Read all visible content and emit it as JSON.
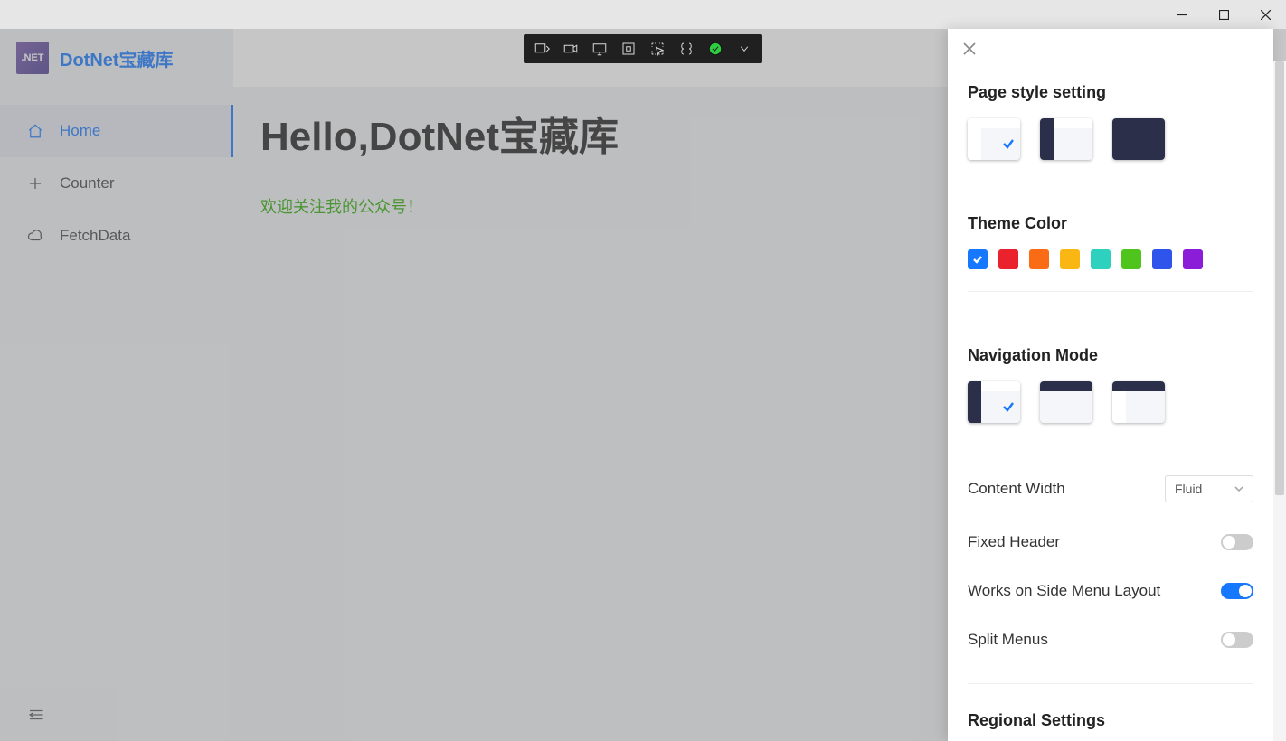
{
  "brand": {
    "logo_text": ".NET",
    "title": "DotNet宝藏库"
  },
  "nav": {
    "items": [
      {
        "label": "Home",
        "active": true,
        "icon": "home"
      },
      {
        "label": "Counter",
        "active": false,
        "icon": "plus"
      },
      {
        "label": "FetchData",
        "active": false,
        "icon": "cloud"
      }
    ]
  },
  "page": {
    "heading": "Hello,DotNet宝藏库",
    "subtext": "欢迎关注我的公众号！"
  },
  "drawer": {
    "sections": {
      "page_style": "Page style setting",
      "theme_color": "Theme Color",
      "nav_mode": "Navigation Mode",
      "regional": "Regional Settings"
    },
    "theme_colors": [
      "#1677ff",
      "#e9222d",
      "#fa6b16",
      "#fab714",
      "#2ed1bd",
      "#4ec41c",
      "#2f54eb",
      "#8b1cd8"
    ],
    "theme_selected_index": 0,
    "page_style_selected_index": 0,
    "nav_mode_selected_index": 0,
    "rows": {
      "content_width": {
        "label": "Content Width",
        "value": "Fluid"
      },
      "fixed_header": {
        "label": "Fixed Header",
        "on": false
      },
      "side_menu": {
        "label": "Works on Side Menu Layout",
        "on": true
      },
      "split_menus": {
        "label": "Split Menus",
        "on": false
      }
    }
  }
}
